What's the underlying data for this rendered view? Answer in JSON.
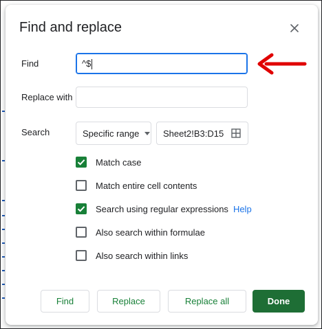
{
  "dialog": {
    "title": "Find and replace",
    "close_icon": "close-icon"
  },
  "find": {
    "label": "Find",
    "value": "^$"
  },
  "replace": {
    "label": "Replace with",
    "value": ""
  },
  "search": {
    "label": "Search",
    "scope_selected": "Specific range",
    "range_value": "Sheet2!B3:D15",
    "range_icon": "grid-icon"
  },
  "options": [
    {
      "label": "Match case",
      "checked": true
    },
    {
      "label": "Match entire cell contents",
      "checked": false
    },
    {
      "label": "Search using regular expressions",
      "checked": true,
      "help": "Help"
    },
    {
      "label": "Also search within formulae",
      "checked": false
    },
    {
      "label": "Also search within links",
      "checked": false
    }
  ],
  "buttons": {
    "find": "Find",
    "replace": "Replace",
    "replace_all": "Replace all",
    "done": "Done"
  },
  "colors": {
    "accent_green": "#188038",
    "done_green": "#1e6e35",
    "focus_blue": "#1a73e8",
    "annotation_red": "#e00000"
  }
}
